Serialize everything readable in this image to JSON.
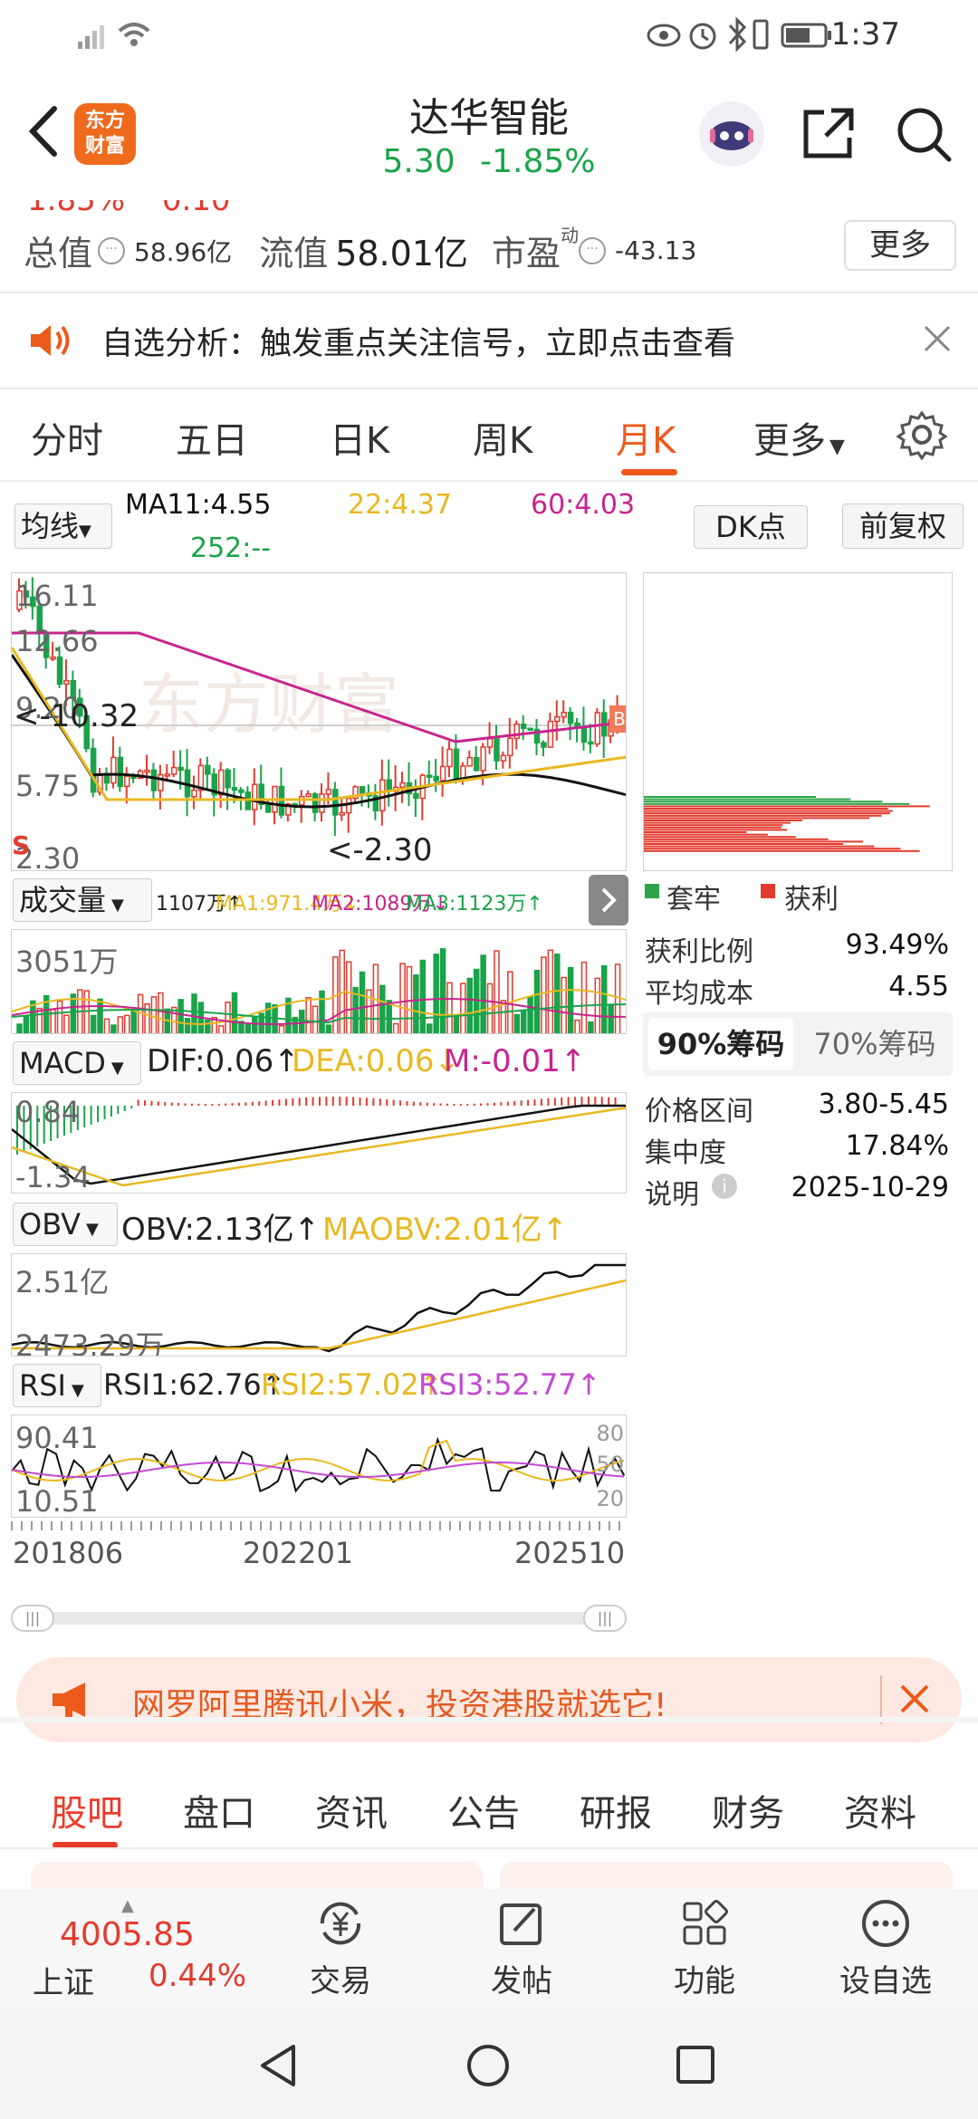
{
  "status_bar": {
    "time": "1:37"
  },
  "header": {
    "logo_text_1": "东方",
    "logo_text_2": "财富",
    "title": "达华智能",
    "price": "5.30",
    "change_pct": "-1.85%"
  },
  "stats": {
    "partial_top_1": "1.85%",
    "partial_top_2": "0.10",
    "total_value_label": "总值",
    "total_value": "58.96亿",
    "float_value_label": "流值",
    "float_value": "58.01亿",
    "pe_label": "市盈",
    "pe_superscript": "动",
    "pe_value": "-43.13",
    "more_button": "更多"
  },
  "alert": {
    "text": "自选分析：触发重点关注信号，立即点击查看"
  },
  "kline_tabs": [
    "分时",
    "五日",
    "日K",
    "周K",
    "月K",
    "更多"
  ],
  "active_kline_tab": "月K",
  "ma_row": {
    "selector": "均线",
    "ma1": "MA11:4.55",
    "ma2": "22:4.37",
    "ma3": "60:4.03",
    "ma4": "252:--",
    "dk_button": "DK点",
    "fq_button": "前复权"
  },
  "main_chart": {
    "y_labels": [
      "16.11",
      "12.66",
      "9.20",
      "5.75",
      "2.30"
    ],
    "high_marker": "<-10.32",
    "low_marker": "<-2.30",
    "s_badge": "S",
    "b_badge": "B",
    "watermark": "东方财富"
  },
  "volume": {
    "selector": "成交量",
    "summary": "1107万↑",
    "ma1": "MA1:971.4万↓",
    "ma2": "MA2:1089万↓",
    "ma3": "MA3:1123万↑",
    "y_label": "3051万"
  },
  "macd": {
    "selector": "MACD",
    "dif": "DIF:0.06↑",
    "dea": "DEA:0.06↓",
    "m": "M:-0.01↑",
    "y_top": "0.84",
    "y_bottom": "-1.34"
  },
  "obv": {
    "selector": "OBV",
    "obv": "OBV:2.13亿↑",
    "maobv": "MAOBV:2.01亿↑",
    "y_top": "2.51亿",
    "y_bottom": "2473.29万"
  },
  "rsi": {
    "selector": "RSI",
    "rsi1": "RSI1:62.76↑",
    "rsi2": "RSI2:57.02↑",
    "rsi3": "RSI3:52.77↑",
    "y_top": "90.41",
    "y_bottom": "10.51",
    "ref_80": "80",
    "ref_50": "50",
    "ref_20": "20"
  },
  "x_axis": [
    "201806",
    "202201",
    "202510"
  ],
  "chip": {
    "legend_trapped": "套牢",
    "legend_profit": "获利",
    "profit_ratio_label": "获利比例",
    "profit_ratio": "93.49%",
    "avg_cost_label": "平均成本",
    "avg_cost": "4.55",
    "tab_90": "90%筹码",
    "tab_70": "70%筹码",
    "range_label": "价格区间",
    "range": "3.80-5.45",
    "concentration_label": "集中度",
    "concentration": "17.84%",
    "note_label": "说明",
    "note_date": "2025-10-29"
  },
  "ad_banner": {
    "text": "网罗阿里腾讯小米，投资港股就选它!"
  },
  "bottom_tabs": [
    "股吧",
    "盘口",
    "资讯",
    "公告",
    "研报",
    "财务",
    "资料"
  ],
  "active_bottom_tab": "股吧",
  "footer": {
    "index_value": "4005.85",
    "index_name": "上证",
    "index_change": "0.44%",
    "trade": "交易",
    "post": "发帖",
    "function": "功能",
    "add_watch": "设自选"
  },
  "colors": {
    "accent": "#ec5a1c",
    "up_red": "#e23b2e",
    "down_green": "#1aa34a",
    "ma_black": "#111111",
    "ma_yellow": "#e8b820",
    "ma_purple": "#c8248c",
    "rsi_purple": "#c24ad0"
  }
}
